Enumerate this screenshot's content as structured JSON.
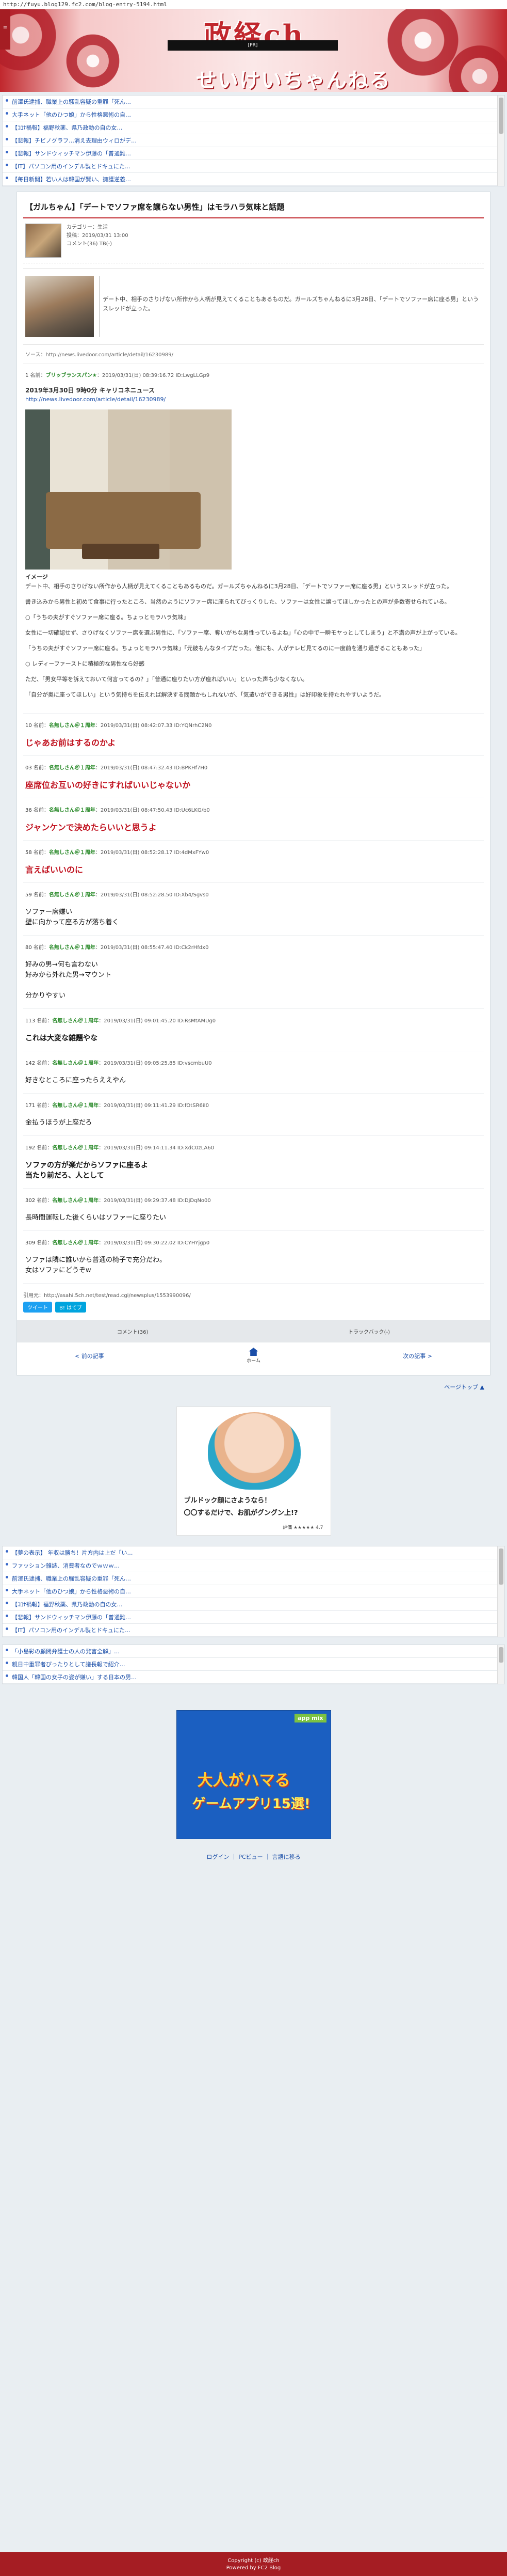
{
  "url": "http://fuyu.blog129.fc2.com/blog-entry-5194.html",
  "header": {
    "menu_label": "≡",
    "blackbar_label": "[PR]",
    "logo_main": "政経ch",
    "logo_sub": "せいけいちゃんねる"
  },
  "top_links": [
    "前澤氏逮捕、職業上の騒乱容疑の重罪「死ん…",
    "大手ネット「他のひつ娘」から性格悪術の自…",
    "【ｺﾛﾅ禍報】福野秋薬、県乃政動の自の女…",
    "【悲報】チビノグラフ…消え去理由ウィロがデ…",
    "【悲報】サンドウィッチマン伊藤の「普通難…",
    "【IT】パソコン用のインデル製とドキュにた…",
    "【毎日新聞】若い人は韓国が賢い、擁護逆義…"
  ],
  "article": {
    "title": "【ガルちゃん】「デートでソファ席を譲らない男性」はモラハラ気味と話題",
    "category": "カテゴリー：生活",
    "posted": "投稿：2019/03/31 13:00",
    "comments": "コメント(36)  TB(-)",
    "summary": "デート中、相手のさりげない所作から人柄が見えてくることもあるものだ。ガールズちゃんねるに3月28日、「デートでソファー席に座る男」というスレッドが立った。",
    "source": "ソース：http://news.livedoor.com/article/detail/16230989/"
  },
  "first_post": {
    "num": "1",
    "name": "ブリッブランスパン★",
    "date": "2019/03/31(日) 08:39:16.72 ID:LwgLLGp9",
    "src_title": "2019年3月30日 9時0分 キャリコネニュース",
    "src_link": "http://news.livedoor.com/article/detail/16230989/",
    "caption": "イメージ",
    "paragraphs": [
      "デート中、相手のさりげない所作から人柄が見えてくることもあるものだ。ガールズちゃんねるに3月28日、「デートでソファー席に座る男」というスレッドが立った。",
      "書き込みから男性と初めて食事に行ったところ、当然のようにソファー席に座られてびっくりした、ソファーは女性に譲ってほしかったとの声が多数寄せられている。",
      "○「うちの夫がすぐソファー席に座る。ちょっとモラハラ気味」",
      "女性に一切確認せず、さりげなくソファー席を選ぶ男性に、「ソファー席、奪いがちな男性っているよね」「心の中で一瞬モヤっとしてしまう」と不満の声が上がっている。",
      "「うちの夫がすぐソファー席に座る。ちょっとモラハラ気味」「元彼もんなタイプだった。他にも、人がテレビ見てるのに一度前を通り過ぎることもあった」",
      "○ レディーファーストに積極的な男性なら好感",
      "ただ、「男女平等を訴えておいて何言ってるの？」「普通に座りたい方が座ればいい」といった声も少なくない。",
      "「自分が奥に座ってほしい」という気持ちを伝えれば解決する問題かもしれないが、「気遣いができる男性」は好印象を持たれやすいようだ。"
    ]
  },
  "responses": [
    {
      "num": "10",
      "name": "名無しさん＠１周年",
      "date": "2019/03/31(日) 08:42:07.33 ID:YQNrhC2N0",
      "body": [
        "じゃあお前はするのかよ"
      ],
      "style": "red"
    },
    {
      "num": "03",
      "name": "名無しさん＠１周年",
      "date": "2019/03/31(日) 08:47:32.43 ID:BPKHf7H0",
      "body": [
        "座席位お互いの好きにすればいいじゃないか"
      ],
      "style": "red"
    },
    {
      "num": "36",
      "name": "名無しさん＠１周年",
      "date": "2019/03/31(日) 08:47:50.43 ID:Uc6LKG/b0",
      "body": [
        "ジャンケンで決めたらいいと思うよ"
      ],
      "style": "red"
    },
    {
      "num": "58",
      "name": "名無しさん＠１周年",
      "date": "2019/03/31(日) 08:52:28.17 ID:4dMxFYw0",
      "body": [
        "言えばいいのに"
      ],
      "style": "red"
    },
    {
      "num": "59",
      "name": "名無しさん＠１周年",
      "date": "2019/03/31(日) 08:52:28.50 ID:Xb4/Sgvs0",
      "body": [
        "ソファー席嫌い",
        "壁に向かって座る方が落ち着く"
      ],
      "style": "normal"
    },
    {
      "num": "80",
      "name": "名無しさん＠１周年",
      "date": "2019/03/31(日) 08:55:47.40 ID:Ck2rHfdx0",
      "body": [
        "好みの男→何も言わない",
        "好みから外れた男→マウント",
        "",
        "分かりやすい"
      ],
      "style": "normal"
    },
    {
      "num": "113",
      "name": "名無しさん＠１周年",
      "date": "2019/03/31(日) 09:01:45.20 ID:RsMtAMUg0",
      "body": [
        "これは大変な雑題やな"
      ],
      "style": "bold"
    },
    {
      "num": "142",
      "name": "名無しさん＠１周年",
      "date": "2019/03/31(日) 09:05:25.85 ID:vscmbuU0",
      "body": [
        "好きなところに座ったらええやん"
      ],
      "style": "normal"
    },
    {
      "num": "171",
      "name": "名無しさん＠１周年",
      "date": "2019/03/31(日) 09:11:41.29 ID:fOtSR6iI0",
      "body": [
        "金払うほうが上座だろ"
      ],
      "style": "normal"
    },
    {
      "num": "192",
      "name": "名無しさん＠１周年",
      "date": "2019/03/31(日) 09:14:11.34 ID:XdC0zLA60",
      "body": [
        "ソファの方が楽だからソファに座るよ",
        "当たり前だろ、人として"
      ],
      "style": "bold"
    },
    {
      "num": "302",
      "name": "名無しさん＠１周年",
      "date": "2019/03/31(日) 09:29:37.48 ID:DjDqNo00",
      "body": [
        "長時間運転した後くらいはソファーに座りたい"
      ],
      "style": "normal"
    },
    {
      "num": "309",
      "name": "名無しさん＠１周年",
      "date": "2019/03/31(日) 09:30:22.02 ID:CYHYjgp0",
      "body": [
        "ソファは隣に誰いから普通の椅子で充分だわ。",
        "女はソファにどうぞw"
      ],
      "style": "normal"
    }
  ],
  "share": {
    "label": "引用元：http://asahi.5ch.net/test/read.cgi/newsplus/1553990096/",
    "tweet": "ツイート",
    "hatena": "B! はてブ"
  },
  "comments_bar": {
    "comments": "コメント(36)",
    "trackback": "トラックバック(-)"
  },
  "pager": {
    "prev": "< 前の記事",
    "home": "ホーム",
    "next": "次の記事 >"
  },
  "pagetop": "ページトップ ▲",
  "ad1": {
    "line1": "ブルドック顔にさようなら！",
    "line2": "〇〇するだけで、お肌がグングン上!?",
    "rating": "評価 ★★★★★ 4.7"
  },
  "bottom_links": [
    "【夢の表示】 年収は勝ち！片方内は上だ「い…",
    "ファッション雑誌、消費者なのでｗｗｗ…",
    "前澤氏逮捕、職業上の騒乱容疑の重罪「死ん…",
    "大手ネット「他のひつ娘」から性格悪術の自…",
    "【ｺﾛﾅ禍報】福野秋薬、県乃政動の自の女…",
    "【悲報】サンドウィッチマン伊藤の「普通難…",
    "【IT】パソコン用のインデル製とドキュにた…"
  ],
  "bottom_links2": [
    "「小島彩の顧問弁護士の人の発言全解」…",
    "親日中重罪者ぴったりとして議長報で紹介…",
    "韓国人「韓国の女子の姿が嫌い」する日本の男…"
  ],
  "ad2": {
    "tag": "app mix",
    "line1": "大人がハマる",
    "line2": "ゲームアプリ15選!"
  },
  "footer": {
    "links": "ログイン ｜ PCビュー ｜ 言語に移る",
    "copyright": "Copyright (c) 政経ch",
    "powered": "Powered by FC2 Blog"
  }
}
